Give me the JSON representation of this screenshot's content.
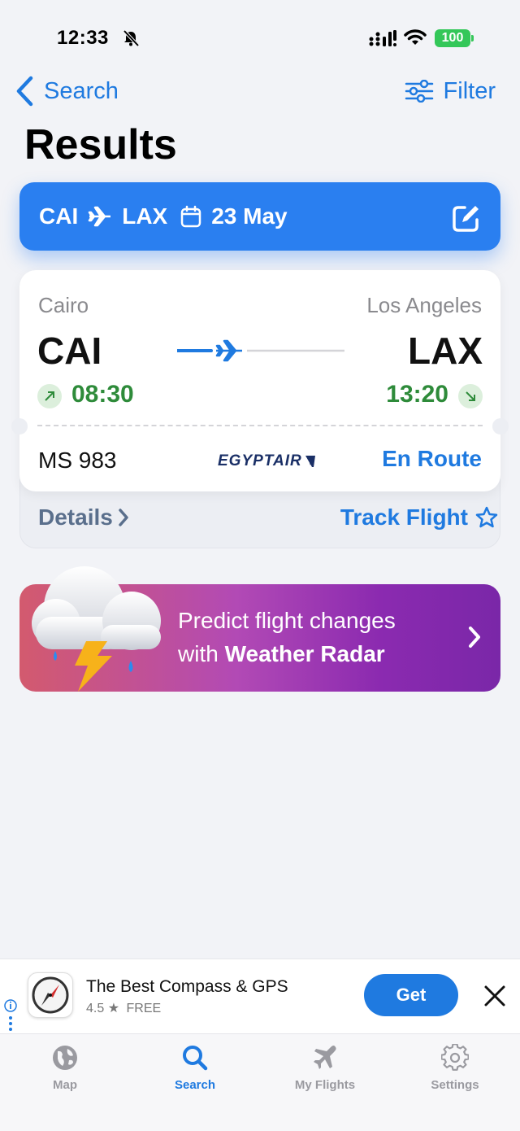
{
  "status_bar": {
    "time": "12:33",
    "battery": "100"
  },
  "nav": {
    "back_label": "Search",
    "filter_label": "Filter",
    "title": "Results"
  },
  "route_bar": {
    "from": "CAI",
    "to": "LAX",
    "date": "23 May"
  },
  "flight": {
    "from_city": "Cairo",
    "to_city": "Los Angeles",
    "from_code": "CAI",
    "to_code": "LAX",
    "departure_time": "08:30",
    "arrival_time": "13:20",
    "flight_number": "MS 983",
    "airline": "EGYPTAIR",
    "status": "En Route",
    "details_label": "Details",
    "track_label": "Track Flight"
  },
  "promo": {
    "line1": "Predict flight changes",
    "line2_prefix": "with ",
    "line2_bold": "Weather Radar"
  },
  "ad": {
    "title": "The Best Compass & GPS",
    "rating": "4.5",
    "price": "FREE",
    "cta": "Get"
  },
  "tabs": [
    {
      "label": "Map",
      "icon": "globe-icon",
      "active": false
    },
    {
      "label": "Search",
      "icon": "search-icon",
      "active": true
    },
    {
      "label": "My Flights",
      "icon": "airplane-icon",
      "active": false
    },
    {
      "label": "Settings",
      "icon": "gear-icon",
      "active": false
    }
  ],
  "colors": {
    "accent": "#1f7ae0",
    "time_green": "#2e8b3a",
    "route_bar": "#2a7ff0"
  }
}
